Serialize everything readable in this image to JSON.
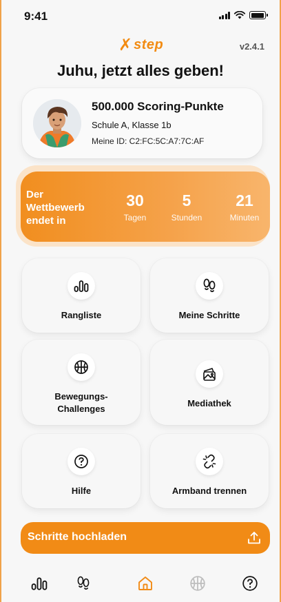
{
  "status_bar": {
    "time": "9:41"
  },
  "header": {
    "logo_text": "step",
    "version": "v2.4.1",
    "headline": "Juhu, jetzt alles geben!"
  },
  "profile": {
    "points": "500.000 Scoring-Punkte",
    "school": "Schule A, Klasse 1b",
    "id_line": "Meine ID: C2:FC:5C:A7:7C:AF"
  },
  "countdown": {
    "label": "Der Wettbewerb endet in",
    "days_value": "30",
    "days_label": "Tagen",
    "hours_value": "5",
    "hours_label": "Stunden",
    "minutes_value": "21",
    "minutes_label": "Minuten"
  },
  "tiles": [
    {
      "label": "Rangliste",
      "icon": "bars-icon"
    },
    {
      "label": "Meine Schritte",
      "icon": "footprints-icon"
    },
    {
      "label": "Bewegungs-\nChallenges",
      "icon": "basketball-icon"
    },
    {
      "label": "Mediathek",
      "icon": "media-library-icon"
    },
    {
      "label": "Hilfe",
      "icon": "help-icon"
    },
    {
      "label": "Armband trennen",
      "icon": "unlink-icon"
    }
  ],
  "upload": {
    "label": "Schritte hochladen",
    "icon": "upload-icon"
  },
  "tabbar": {
    "items": [
      "bars-icon",
      "footprints-icon",
      "home-icon",
      "basketball-icon",
      "help-icon"
    ],
    "active": "home-icon"
  },
  "colors": {
    "accent": "#f18b16",
    "inactive_tab": "#bdbdbd",
    "text": "#111111"
  }
}
